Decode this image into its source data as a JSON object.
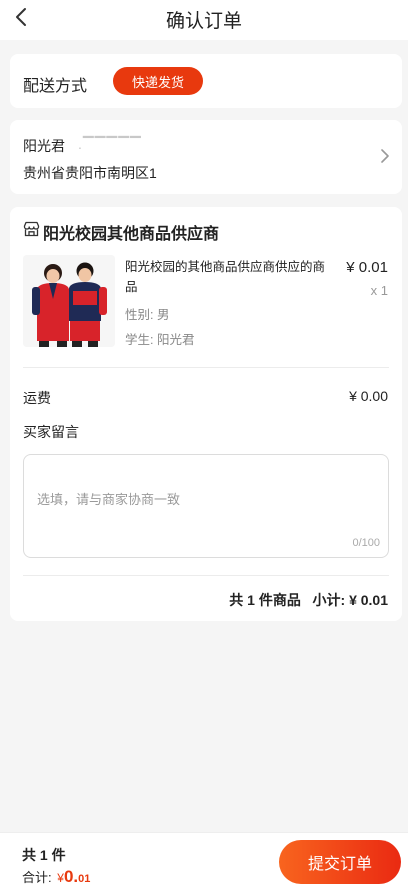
{
  "nav": {
    "title": "确认订单",
    "back_icon": "chevron-left-icon"
  },
  "delivery": {
    "label": "配送方式",
    "method": "快递发货",
    "accent": "#e8390e"
  },
  "address": {
    "name": "阳光君",
    "phone_masked": ".▔▔▔▔▔",
    "address": "贵州省贵阳市南明区1",
    "chevron_icon": "chevron-right-icon"
  },
  "order": {
    "shop_icon": "store-icon",
    "shop_name": "阳光校园其他商品供应商",
    "product": {
      "image": "school-uniform-photo",
      "name": "阳光校园的其他商品供应商供应的商品",
      "spec_gender": "性别: 男",
      "spec_student": "学生: 阳光君",
      "price": "¥ 0.01",
      "qty": "x 1"
    },
    "shipping_label": "运费",
    "shipping_value": "¥ 0.00",
    "message_label": "买家留言",
    "message_placeholder": "选填，请与商家协商一致",
    "message_count": "0/100",
    "summary_count": "共 1 件商品",
    "summary_subtotal_label": "小计:",
    "summary_subtotal": "¥ 0.01"
  },
  "bottom": {
    "count": "共 1 件",
    "total_label": "合计:",
    "currency": "¥",
    "total_int": "0.",
    "total_dec": "01",
    "submit_label": "提交订单",
    "button_gradient": [
      "#f8641e",
      "#ea2a12"
    ]
  }
}
